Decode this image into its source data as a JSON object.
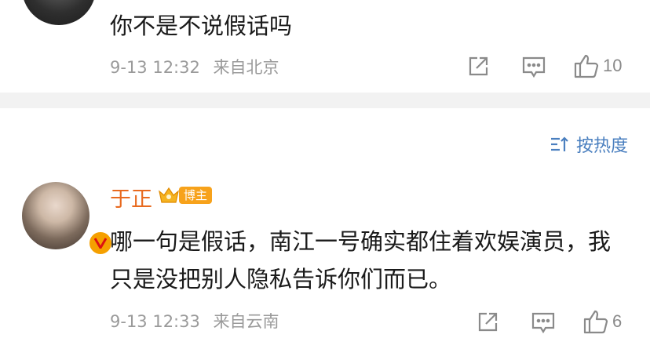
{
  "comments": [
    {
      "text": "你不是不说假话吗",
      "date": "9-13 12:32",
      "location": "来自北京",
      "likes": "10"
    },
    {
      "author": "于正",
      "badge": "博主",
      "text": "哪一句是假话，南江一号确实都住着欢娱演员，我只是没把别人隐私告诉你们而已。",
      "date": "9-13 12:33",
      "location": "来自云南",
      "likes": "6"
    }
  ],
  "sort": {
    "label": "按热度"
  },
  "colors": {
    "username": "#e86a1f",
    "badge": "#f7a21b",
    "sort": "#4a7fbf",
    "meta": "#9a9a9a"
  }
}
